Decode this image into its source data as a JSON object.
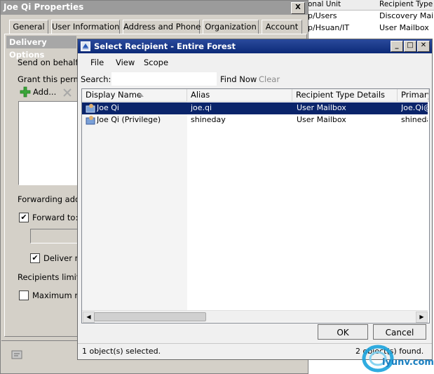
{
  "background_list": {
    "headers": [
      "onal Unit",
      "Recipient Type"
    ],
    "rows": [
      [
        "p/Users",
        "Discovery Mailb"
      ],
      [
        "p/Hsuan/IT",
        "User Mailbox"
      ]
    ]
  },
  "properties_window": {
    "title": "Joe Qi Properties",
    "close_label": "X",
    "tabs": [
      "General",
      "User Information",
      "Address and Phone",
      "Organization",
      "Account"
    ],
    "section_title": "Delivery Options",
    "send_on_behalf": "Send on behalf",
    "grant_label": "Grant this permiss",
    "add_button": "Add...",
    "forwarding_label": "Forwarding addre",
    "forward_to": "Forward to:",
    "forward_to_checked": true,
    "deliver_label": "Deliver me",
    "deliver_checked": true,
    "recipients_limits": "Recipients limits",
    "maximum_label": "Maximum reci",
    "maximum_checked": false
  },
  "dialog": {
    "title": "Select Recipient - Entire Forest",
    "menus": [
      "File",
      "View",
      "Scope"
    ],
    "search_label": "Search:",
    "search_value": "",
    "find_now": "Find Now",
    "clear": "Clear",
    "columns": [
      "Display Name",
      "Alias",
      "Recipient Type Details",
      "Primary"
    ],
    "rows": [
      {
        "name": "Joe Qi",
        "alias": "joe.qi",
        "type": "User Mailbox",
        "primary": "Joe.Qi@",
        "selected": true
      },
      {
        "name": "Joe Qi (Privilege)",
        "alias": "shineday",
        "type": "User Mailbox",
        "primary": "shineday",
        "selected": false
      }
    ],
    "ok": "OK",
    "cancel": "Cancel",
    "status_left": "1 object(s) selected.",
    "status_right": "2 object(s) found."
  },
  "watermark": {
    "text": "iyunv.com"
  },
  "colors": {
    "title_active": "#0c2a78",
    "selection": "#0a246a",
    "add_green": "#3aa63a"
  }
}
